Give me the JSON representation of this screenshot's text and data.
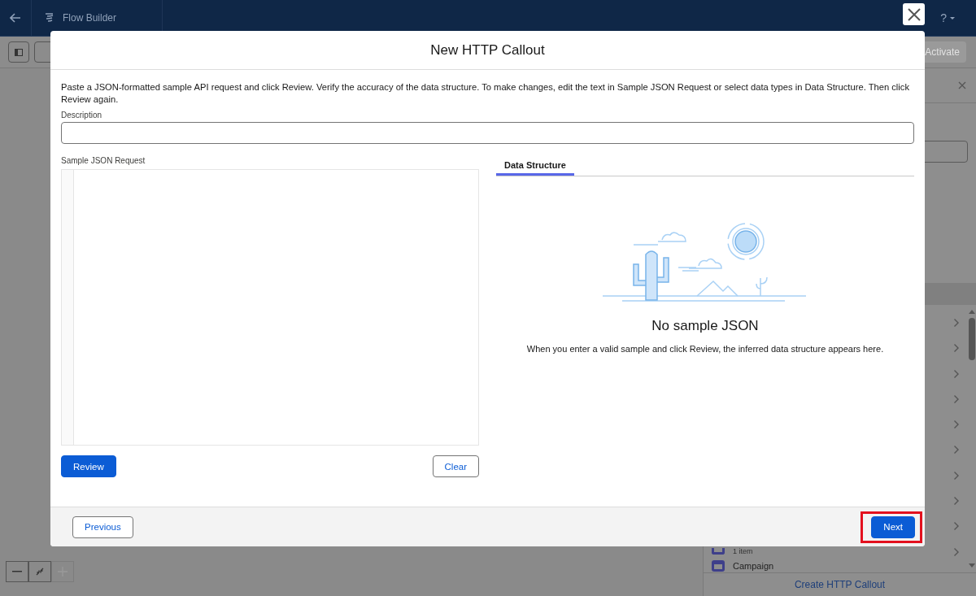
{
  "app_header": {
    "title": "Flow Builder",
    "help": "?"
  },
  "toolbar": {
    "activate_button": {
      "label": "Activate",
      "disabled": true
    }
  },
  "right_panel": {
    "list_items": [
      {
        "text": "1 item",
        "kind": "subtext"
      },
      {
        "text": "Campaign",
        "kind": "entry"
      }
    ],
    "footer_link": "Create HTTP Callout"
  },
  "modal": {
    "title": "New HTTP Callout",
    "intro": "Paste a JSON-formatted sample API request and click Review. Verify the accuracy of the data structure. To make changes, edit the text in Sample JSON Request or select data types in Data Structure. Then click Review again.",
    "description": {
      "label": "Description"
    },
    "sample_request": {
      "label": "Sample JSON Request"
    },
    "tabs": [
      {
        "label": "Data Structure",
        "selected": true
      }
    ],
    "empty_state": {
      "title": "No sample JSON",
      "message": "When you enter a valid sample and click Review, the inferred data structure appears here."
    },
    "buttons": [
      {
        "label": "Review",
        "kind": "brand",
        "highlighted": false
      },
      {
        "label": "Clear",
        "kind": "neutral",
        "highlighted": false
      }
    ],
    "footer_buttons": [
      {
        "label": "Previous",
        "kind": "neutral",
        "highlighted": false
      },
      {
        "label": "Next",
        "kind": "brand",
        "highlighted": true
      }
    ]
  }
}
